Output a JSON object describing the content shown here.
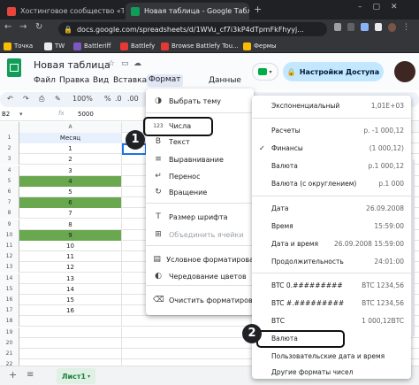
{
  "browser": {
    "tabs": [
      {
        "title": "Хостинговое сообщество «Tim",
        "active": false
      },
      {
        "title": "Новая таблица - Google Табли",
        "active": true
      }
    ],
    "url": "docs.google.com/spreadsheets/d/1WVu_cf7i3kP4dTpmFkFhyyj...",
    "bookmarks": [
      "Точка",
      "TW",
      "Battleriff",
      "Battlefy",
      "Browse Battlefy Tou...",
      "Фермы"
    ]
  },
  "doc": {
    "title": "Новая таблица",
    "menu": [
      "Файл",
      "Правка",
      "Вид",
      "Вставка",
      "Формат",
      "Данные"
    ],
    "share_label": "Настройки Доступа",
    "zoom": "100%",
    "toolbar_items": [
      "%",
      ".0",
      ".00",
      "123"
    ]
  },
  "formula_bar": {
    "cell_ref": "B2",
    "fx": "fx",
    "value": "5000"
  },
  "grid": {
    "col_a": "A",
    "header": "Месяц",
    "rows": [
      {
        "n": "1",
        "v": "Месяц",
        "green": false
      },
      {
        "n": "2",
        "v": "1",
        "green": false
      },
      {
        "n": "3",
        "v": "2",
        "green": false
      },
      {
        "n": "4",
        "v": "3",
        "green": false
      },
      {
        "n": "5",
        "v": "4",
        "green": true
      },
      {
        "n": "6",
        "v": "5",
        "green": false
      },
      {
        "n": "7",
        "v": "6",
        "green": true
      },
      {
        "n": "8",
        "v": "7",
        "green": false
      },
      {
        "n": "9",
        "v": "8",
        "green": false
      },
      {
        "n": "10",
        "v": "9",
        "green": true
      },
      {
        "n": "11",
        "v": "10",
        "green": false
      },
      {
        "n": "12",
        "v": "11",
        "green": false
      },
      {
        "n": "13",
        "v": "12",
        "green": false
      },
      {
        "n": "14",
        "v": "13",
        "green": false
      },
      {
        "n": "15",
        "v": "14",
        "green": false
      },
      {
        "n": "16",
        "v": "15",
        "green": false
      },
      {
        "n": "17",
        "v": "16",
        "green": false
      },
      {
        "n": "18",
        "v": "",
        "green": false
      },
      {
        "n": "19",
        "v": "",
        "green": false
      },
      {
        "n": "20",
        "v": "",
        "green": false
      },
      {
        "n": "21",
        "v": "",
        "green": false
      },
      {
        "n": "22",
        "v": "",
        "green": false
      }
    ]
  },
  "format_menu": [
    {
      "icon": "theme-icon",
      "glyph": "◑",
      "label": "Выбрать тему",
      "disabled": false
    },
    {
      "icon": "numbers-icon",
      "glyph": "123",
      "label": "Числа",
      "disabled": false
    },
    {
      "icon": "bold-icon",
      "glyph": "B",
      "label": "Текст",
      "disabled": false
    },
    {
      "icon": "align-icon",
      "glyph": "≡",
      "label": "Выравнивание",
      "disabled": false
    },
    {
      "icon": "wrap-icon",
      "glyph": "↵",
      "label": "Перенос",
      "disabled": false
    },
    {
      "icon": "rotate-icon",
      "glyph": "↻",
      "label": "Вращение",
      "disabled": false
    },
    {
      "icon": "font-size-icon",
      "glyph": "T",
      "label": "Размер шрифта",
      "disabled": false
    },
    {
      "icon": "merge-icon",
      "glyph": "⊞",
      "label": "Объединить ячейки",
      "disabled": true
    },
    {
      "icon": "conditional-format-icon",
      "glyph": "▤",
      "label": "Условное форматирова",
      "disabled": false
    },
    {
      "icon": "alternating-colors-icon",
      "glyph": "◐",
      "label": "Чередование цветов",
      "disabled": false
    },
    {
      "icon": "clear-format-icon",
      "glyph": "⌫",
      "label": "Очистить форматирова",
      "disabled": false
    }
  ],
  "numbers_menu": [
    {
      "label": "Экспоненциальный",
      "example": "1,01E+03",
      "checked": false
    },
    {
      "label": "Расчеты",
      "example": "р. -1 000,12",
      "checked": false
    },
    {
      "label": "Финансы",
      "example": "(1 000,12)",
      "checked": true
    },
    {
      "label": "Валюта",
      "example": "р.1 000,12",
      "checked": false
    },
    {
      "label": "Валюта (с округлением)",
      "example": "р.1 000",
      "checked": false
    },
    {
      "label": "Дата",
      "example": "26.09.2008",
      "checked": false
    },
    {
      "label": "Время",
      "example": "15:59:00",
      "checked": false
    },
    {
      "label": "Дата и время",
      "example": "26.09.2008 15:59:00",
      "checked": false
    },
    {
      "label": "Продолжительность",
      "example": "24:01:00",
      "checked": false
    },
    {
      "label": "BTC 0.#########",
      "example": "BTC 1234,56",
      "checked": false
    },
    {
      "label": "BTC #.#########",
      "example": "BTC 1234,56",
      "checked": false
    },
    {
      "label": "ВТС",
      "example": "1 000,12BTC",
      "checked": false
    },
    {
      "label": "Валюта",
      "example": "",
      "checked": false
    },
    {
      "label": "Пользовательские дата и время",
      "example": "",
      "checked": false
    },
    {
      "label": "Другие форматы чисел",
      "example": "",
      "checked": false
    }
  ],
  "sheet_tab": "Лист1",
  "badges": [
    "1",
    "2"
  ],
  "colors": {
    "green_fill": "#6aa84f",
    "share_button": "#c2e7ff",
    "sheets_green": "#0f9d58"
  }
}
